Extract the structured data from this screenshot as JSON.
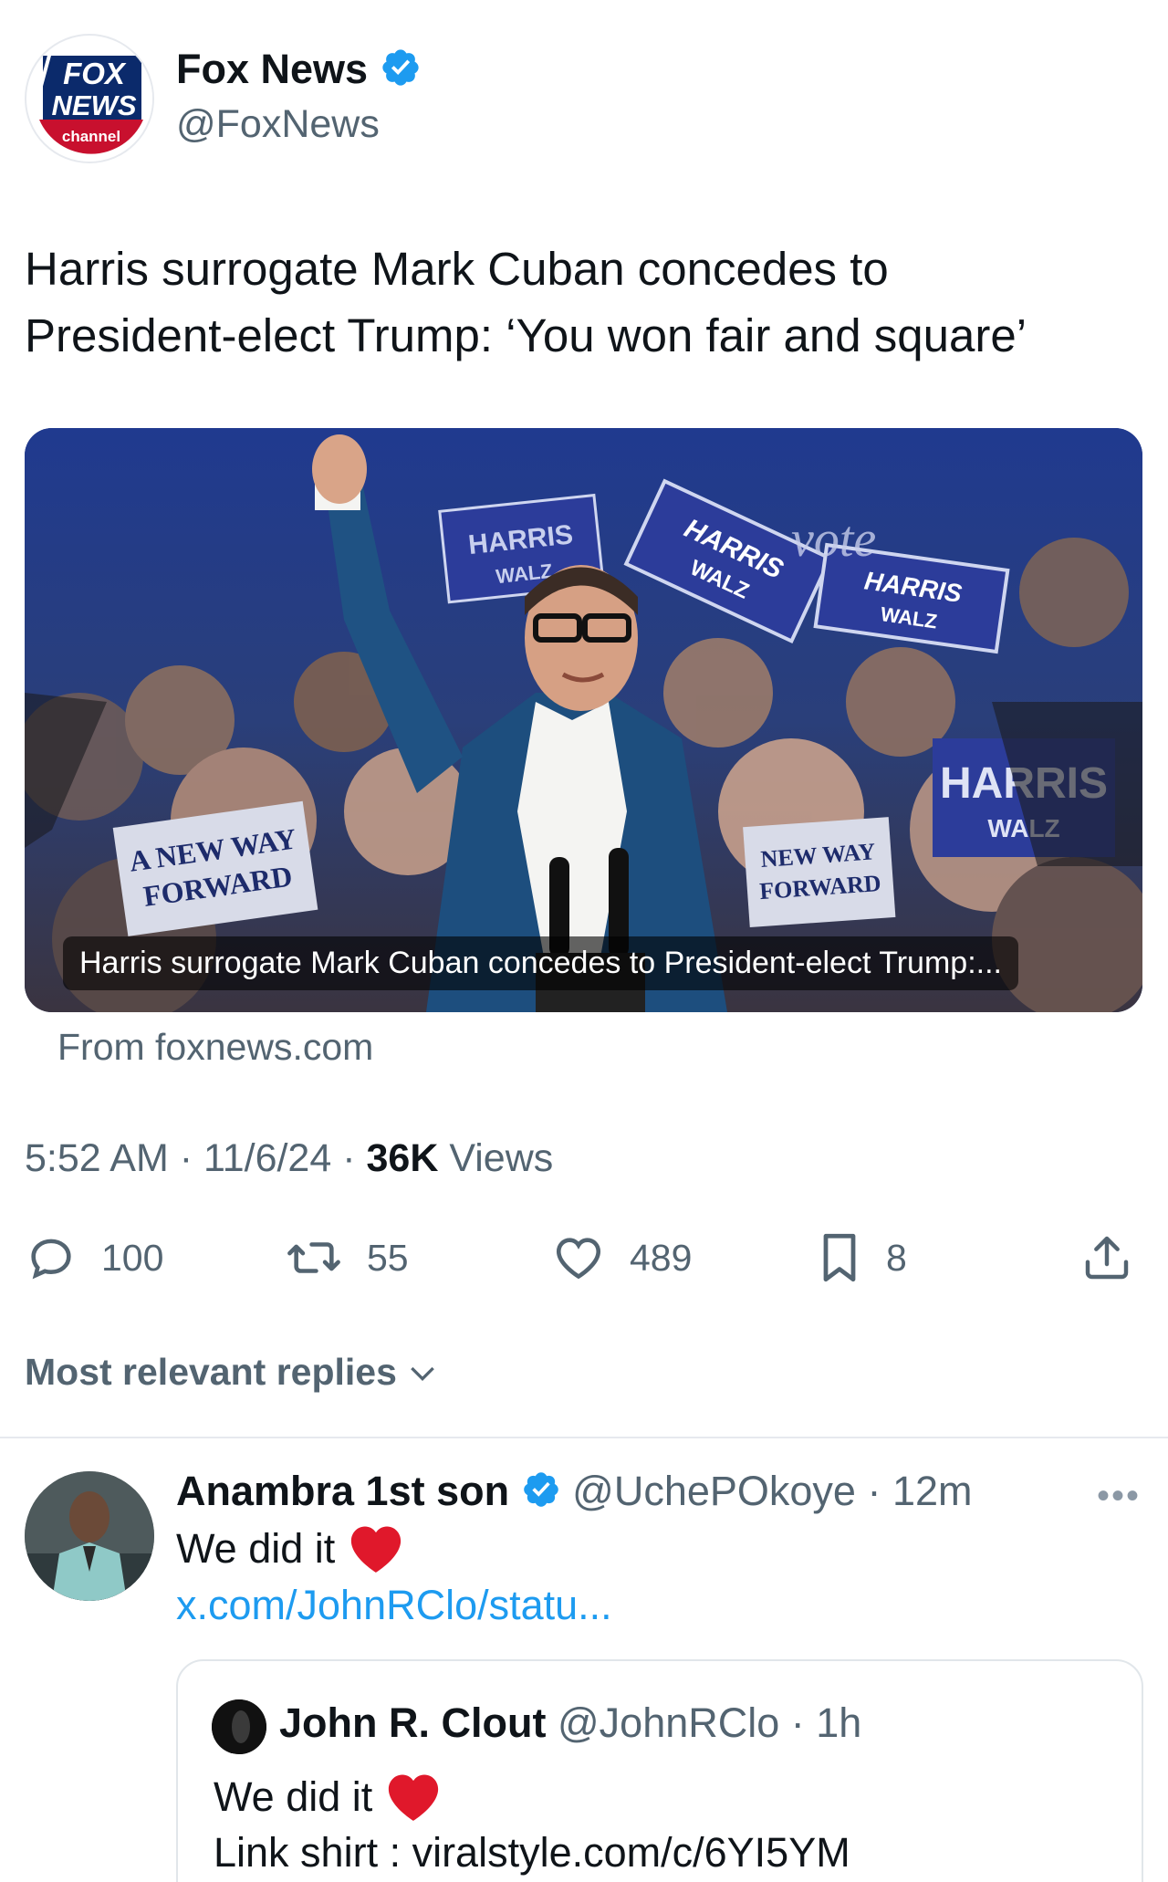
{
  "post": {
    "author_logo_text": [
      "FOX",
      "NEWS",
      "channel"
    ],
    "author_name": "Fox News",
    "author_handle": "@FoxNews",
    "text_line1": "Harris surrogate Mark Cuban concedes to",
    "text_line2": "President-elect Trump: ‘You won fair and square’",
    "card": {
      "caption": "Harris surrogate Mark Cuban concedes to President-elect Trump:...",
      "source": "From foxnews.com",
      "sign_texts": [
        "A NEW WAY",
        "FORWARD",
        "HARRIS",
        "WALZ",
        "NEW WAY",
        "FORWARD",
        "vote"
      ]
    },
    "time": "5:52 AM",
    "date": "11/6/24",
    "views_count": "36K",
    "views_label": "Views",
    "actions": {
      "replies": "100",
      "reposts": "55",
      "likes": "489",
      "bookmarks": "8"
    }
  },
  "replies_sort_label": "Most relevant replies",
  "reply": {
    "name": "Anambra 1st son",
    "handle": "@UchePOkoye",
    "time": "12m",
    "text": "We did it",
    "link": "x.com/JohnRClo/statu...",
    "quote": {
      "name": "John R. Clout",
      "handle": "@JohnRClo",
      "time": "1h",
      "text": "We did it",
      "text2": "Link shirt : viralstyle.com/c/6YI5YM"
    }
  },
  "colors": {
    "verified_blue": "#1d9bf0",
    "secondary_text": "#536471",
    "link_blue": "#1d9bf0",
    "heart_red": "#e0182b"
  }
}
